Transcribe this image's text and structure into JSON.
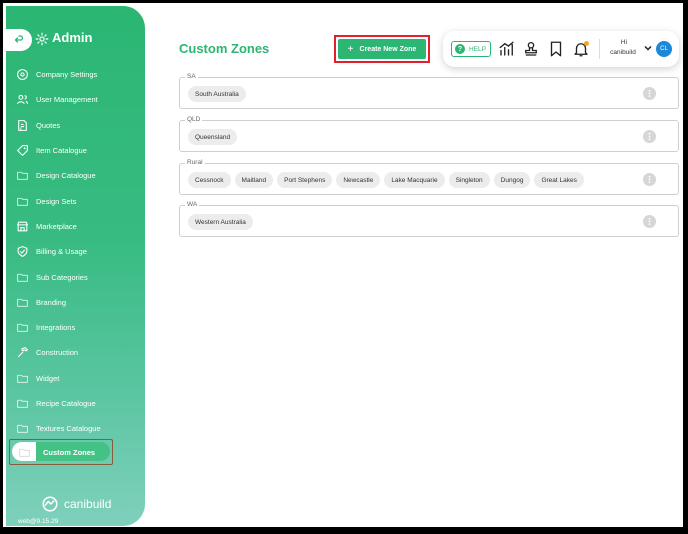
{
  "app": {
    "title": "Admin",
    "logo_text": "canibuild",
    "version": "web@9.15.29"
  },
  "sidebar": {
    "items": [
      {
        "label": "Company Settings",
        "icon": "settings-circle-icon"
      },
      {
        "label": "User Management",
        "icon": "users-icon"
      },
      {
        "label": "Quotes",
        "icon": "quote-document-icon"
      },
      {
        "label": "Item Catalogue",
        "icon": "tag-icon"
      },
      {
        "label": "Design Catalogue",
        "icon": "folder-icon"
      },
      {
        "label": "Design Sets",
        "icon": "folder-icon"
      },
      {
        "label": "Marketplace",
        "icon": "store-icon"
      },
      {
        "label": "Billing & Usage",
        "icon": "shield-check-icon"
      },
      {
        "label": "Sub Categories",
        "icon": "folder-icon"
      },
      {
        "label": "Branding",
        "icon": "folder-icon"
      },
      {
        "label": "Integrations",
        "icon": "folder-icon"
      },
      {
        "label": "Construction",
        "icon": "hammer-icon"
      },
      {
        "label": "Widget",
        "icon": "folder-icon"
      },
      {
        "label": "Recipe Catalogue",
        "icon": "folder-icon"
      },
      {
        "label": "Textures Catalogue",
        "icon": "folder-icon"
      },
      {
        "label": "Custom Zones",
        "icon": "folder-icon",
        "active": true
      }
    ]
  },
  "main": {
    "title": "Custom Zones",
    "create_button_label": "Create New Zone"
  },
  "topbar": {
    "help_label": "HELP",
    "user_greeting": "Hi",
    "user_name": "canibuild",
    "avatar_initials": "CL"
  },
  "zones": [
    {
      "name": "SA",
      "chips": [
        "South Australia"
      ]
    },
    {
      "name": "QLD",
      "chips": [
        "Queensland"
      ]
    },
    {
      "name": "Rural",
      "chips": [
        "Cessnock",
        "Maitland",
        "Port Stephens",
        "Newcastle",
        "Lake Macquarie",
        "Singleton",
        "Dungog",
        "Great Lakes"
      ]
    },
    {
      "name": "WA",
      "chips": [
        "Western Australia"
      ]
    }
  ],
  "colors": {
    "brand_green": "#2bb673",
    "highlight_red": "#e0212a",
    "avatar_blue": "#1e88d8",
    "notification_orange": "#f5a623"
  }
}
